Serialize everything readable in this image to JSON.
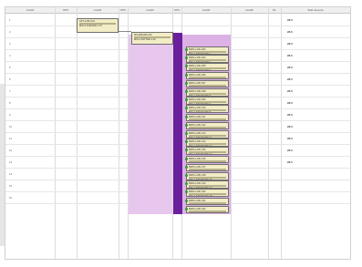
{
  "columns": [
    {
      "label": "Line01"
    },
    {
      "label": "OPS"
    },
    {
      "label": "Line02"
    },
    {
      "label": "OPS"
    },
    {
      "label": "Line03"
    },
    {
      "label": "OPS"
    },
    {
      "label": "Line04"
    },
    {
      "label": "Line05"
    },
    {
      "label": "DL"
    },
    {
      "label": "Total resource"
    }
  ],
  "rows": [
    {
      "label": "1",
      "total": "28.0"
    },
    {
      "label": "2",
      "total": "28.0"
    },
    {
      "label": "3",
      "total": "28.0"
    },
    {
      "label": "4",
      "total": "28.0"
    },
    {
      "label": "5",
      "total": "28.0"
    },
    {
      "label": "6",
      "total": "28.0"
    },
    {
      "label": "7",
      "total": "28.0"
    },
    {
      "label": "8",
      "total": "28.0"
    },
    {
      "label": "9",
      "total": "28.0"
    },
    {
      "label": "10",
      "total": "28.0"
    },
    {
      "label": "11",
      "total": "28.0"
    },
    {
      "label": "12",
      "total": "28.0"
    },
    {
      "label": "13",
      "total": "28.0"
    },
    {
      "label": "14",
      "total": ""
    },
    {
      "label": "15",
      "total": ""
    },
    {
      "label": "16",
      "total": ""
    }
  ],
  "jobs": [
    {
      "line1": "SPT-2-MF-001",
      "line2": "MIS-2-CHRAND-1-37"
    },
    {
      "line1": "MIS-BRAND-001",
      "line2": "MIS-2-PATTER-1-40"
    },
    {
      "line1": "BMIS-2-MF-003",
      "line2": "MIS-2-STANDARD-1"
    },
    {
      "line1": "BMIS-2-MF-004",
      "line2": "MIS-2-STANDARD-2"
    },
    {
      "line1": "BMIS-2-MF-005",
      "line2": "MIS-2-STANDARD-3"
    },
    {
      "line1": "BMIS-2-MF-006",
      "line2": "MIS-2-STANDARD-4"
    },
    {
      "line1": "BMIS-2-MF-007",
      "line2": "MIS-2-STANDARD-5"
    },
    {
      "line1": "BMIS-2-MF-008",
      "line2": "MIS-2-STANDARD-6"
    },
    {
      "line1": "BMIS-2-MF-009",
      "line2": "MIS-2-STANDARD-7"
    },
    {
      "line1": "BMIS-2-MF-010",
      "line2": "MIS-2-STANDARD-8"
    },
    {
      "line1": "BMIS-2-MF-011",
      "line2": "MIS-2-STANDARD-9"
    },
    {
      "line1": "BMIS-2-MF-012",
      "line2": "MIS-2-STANDARD-10"
    },
    {
      "line1": "BMIS-2-MF-013",
      "line2": "MIS-2-STANDARD-11"
    },
    {
      "line1": "BMIS-2-MF-014",
      "line2": "MIS-2-STANDARD-12"
    },
    {
      "line1": "BMIS-2-MF-015",
      "line2": "MIS-2-STANDARD-13"
    },
    {
      "line1": "BMIS-2-MF-016",
      "line2": "MIS-2-STANDARD-14"
    },
    {
      "line1": "BMIS-2-MF-017",
      "line2": "MIS-2-STANDARD-15"
    },
    {
      "line1": "BMIS-2-MF-018",
      "line2": "MIS-2-STANDARD-16"
    },
    {
      "line1": "BMIS-2-MF-019",
      "line2": "MIS-2-STANDARD-17"
    },
    {
      "line1": "BMIS-2-MF-020",
      "line2": "MIS-2-STANDARD-18"
    },
    {
      "line1": "BMIS-2-MF-021",
      "line2": "MIS-2-STANDARD-19"
    },
    {
      "line1": "BMIS-2-MF-022",
      "line2": "MIS-2-STANDARD-20"
    }
  ],
  "colors": {
    "shade_light": "#e7c7ee",
    "shade_mid": "#dcb2e6",
    "bar_purple": "#6a1f9c",
    "job_fill": "#f3edc6",
    "status_ok": "#2e9a3a"
  }
}
